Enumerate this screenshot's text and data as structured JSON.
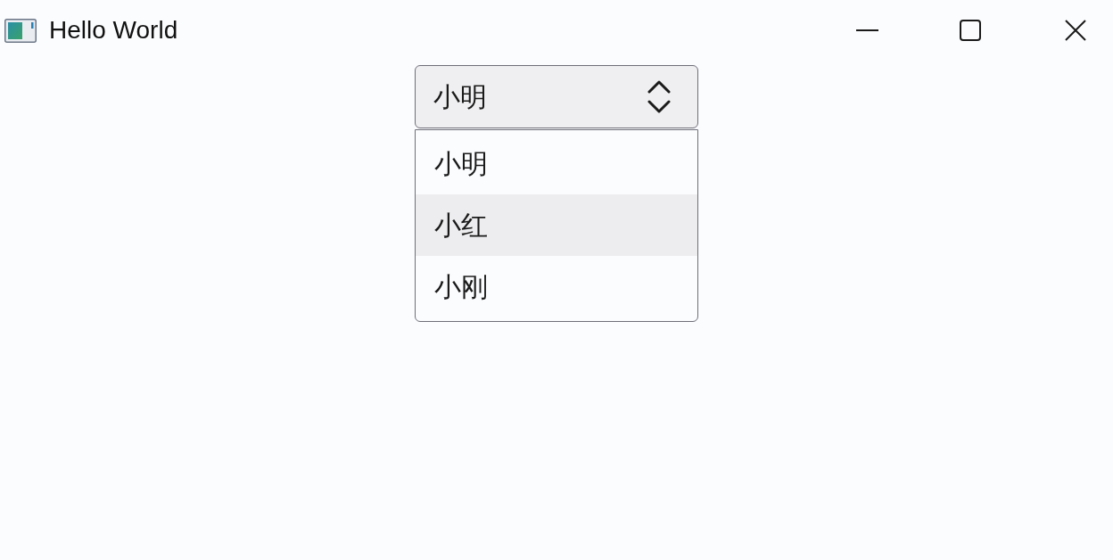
{
  "window": {
    "title": "Hello World"
  },
  "combo_box": {
    "value": "小明",
    "expanded": true
  },
  "options": [
    {
      "label": "小明",
      "highlighted": false
    },
    {
      "label": "小红",
      "highlighted": true
    },
    {
      "label": "小刚",
      "highlighted": false
    }
  ]
}
